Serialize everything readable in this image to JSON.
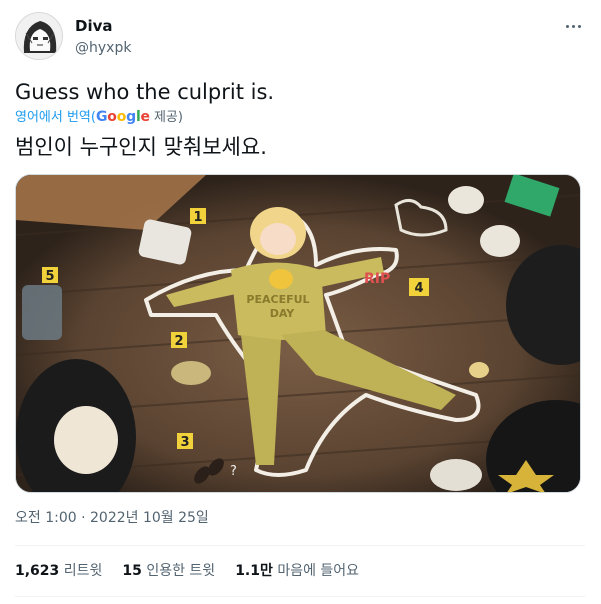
{
  "author": {
    "display_name": "Diva",
    "handle": "@hyxpk",
    "avatar_icon": "avatar-anime-icon"
  },
  "tweet": {
    "text": "Guess who the culprit is.",
    "translate_prefix": "영어에서 번역(",
    "translate_google": [
      "G",
      "o",
      "o",
      "g",
      "l",
      "e"
    ],
    "translate_suffix": " 제공)",
    "translated_text": "범인이 누구인지 맞춰보세요.",
    "timestamp": "오전 1:00 · 2022년 10월 25일"
  },
  "media": {
    "shirt_text_line1": "PEACEFUL",
    "shirt_text_line2": "DAY",
    "rip_text": "RIP",
    "markers": [
      "1",
      "2",
      "3",
      "4",
      "5"
    ],
    "question_mark": "?"
  },
  "stats": {
    "retweets_count": "1,623",
    "retweets_label": "리트윗",
    "quotes_count": "15",
    "quotes_label": "인용한 트윗",
    "likes_count": "1.1만",
    "likes_label": "마음에 들어요"
  },
  "colors": {
    "link": "#1d9bf0",
    "secondary_text": "#536471",
    "primary_text": "#0f1419",
    "divider": "#eff3f4"
  }
}
